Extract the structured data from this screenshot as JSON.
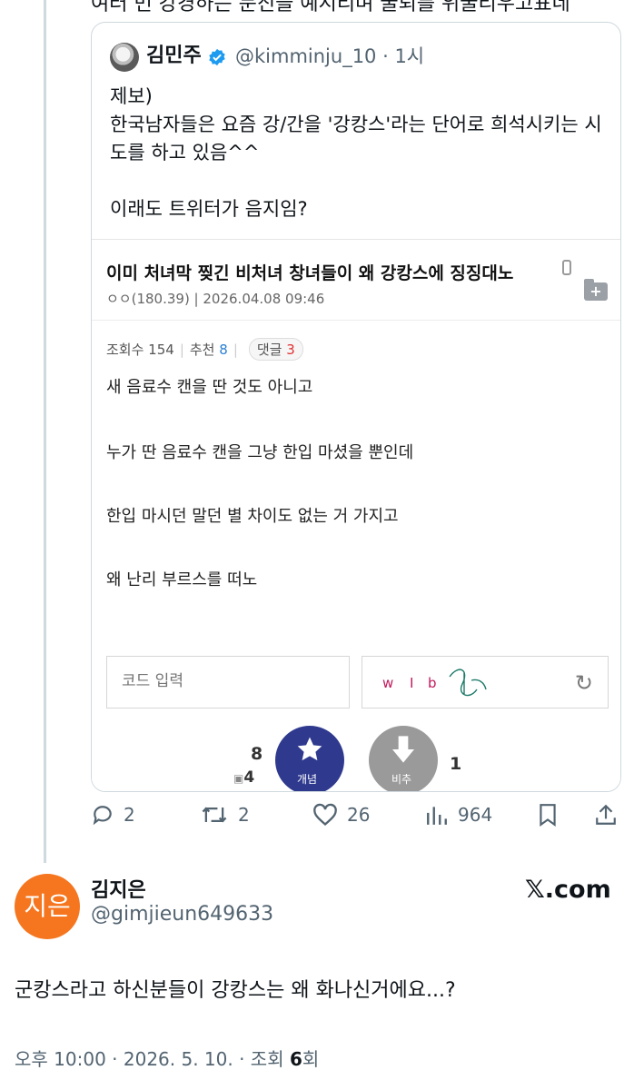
{
  "prev_tweet": {
    "cut_text": "여러 번 강경하는 문진을 예시리며 굴퇴를 위굴리우고표네"
  },
  "quote": {
    "name": "김민주",
    "handle": "@kimminju_10 · 1시",
    "body": "제보)\n한국남자들은 요즘 강/간을 '강캉스'라는 단어로 희석시키는 시도를 하고 있음^^\n\n이래도 트위터가 음지임?",
    "article": {
      "title": "이미 처녀막 찢긴 비처녀 창녀들이 왜 강캉스에 징징대노",
      "meta": "ㅇㅇ(180.39)  |  2026.04.08 09:46",
      "views_label": "조회수 154",
      "recommend_label": "추천",
      "recommend_count": "8",
      "comments_label": "댓글",
      "comments_count": "3",
      "lines": [
        "새 음료수 캔을 딴 것도 아니고",
        "누가 딴 음료수 캔을 그냥 한입 마셨을 뿐인데",
        "한입 마시던 말던 별 차이도 없는 거 가지고",
        "왜 난리 부르스를 떠노"
      ],
      "code_placeholder": "코드 입력",
      "captcha_text": "w I b 나",
      "upvote_count": "8",
      "upvote_sub": "4",
      "upvote_label": "개념",
      "downvote_label": "비추",
      "downvote_count": "1"
    }
  },
  "actions": {
    "replies": "2",
    "retweets": "2",
    "likes": "26",
    "views": "964"
  },
  "main_tweet": {
    "avatar_text": "지은",
    "name": "김지은",
    "handle": "@gimjieun649633",
    "brand": "𝕏.com",
    "text": "군캉스라고 하신분들이 강캉스는 왜 화나신거에요...?",
    "time": "오후 10:00 · 2026. 5. 10. · 조회 ",
    "view_count": "6",
    "view_suffix": "회"
  },
  "colors": {
    "accent": "#1d9bf0",
    "upvote": "#2f3a8f",
    "downvote": "#9a9a9a",
    "avatar": "#f5761f"
  }
}
